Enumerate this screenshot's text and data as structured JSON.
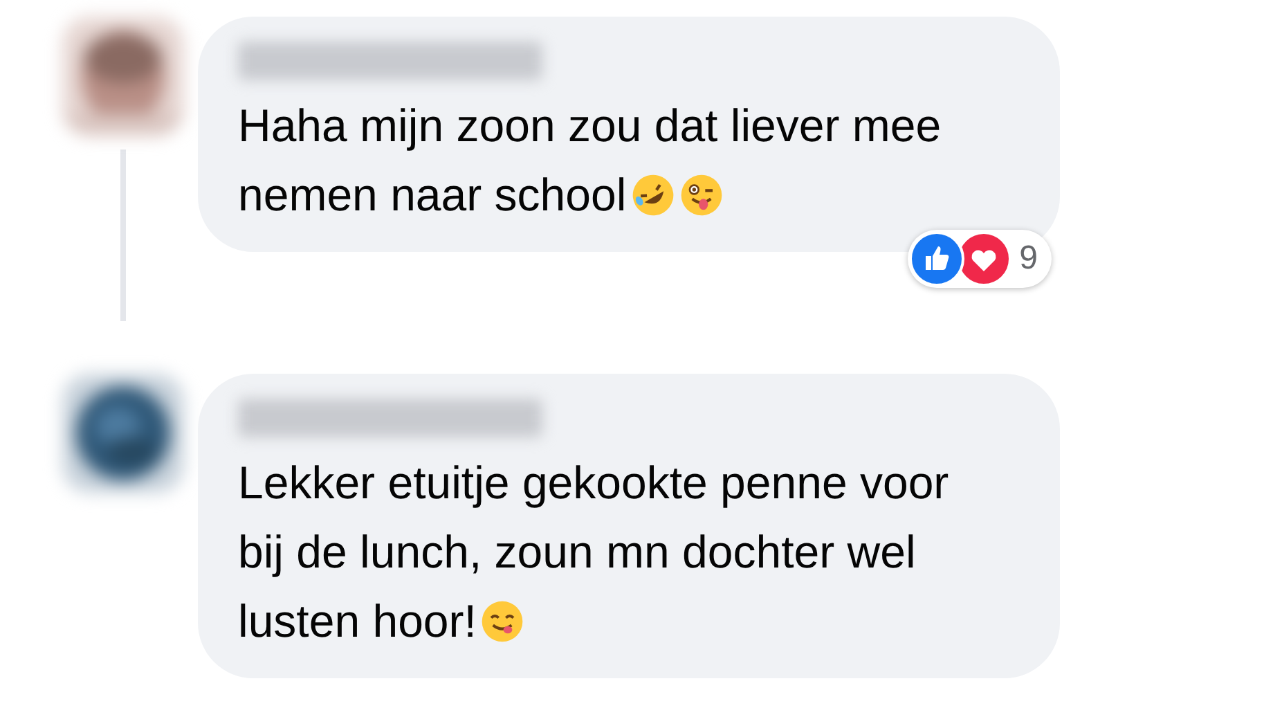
{
  "comments": [
    {
      "lines": [
        "Haha mijn zoon zou dat liever mee",
        "nemen naar school"
      ],
      "emojis": [
        {
          "kind": "rofl"
        },
        {
          "kind": "wink"
        }
      ],
      "reactions": {
        "items": [
          {
            "kind": "like"
          },
          {
            "kind": "love"
          }
        ],
        "count": "9"
      },
      "has_thread_line": true
    },
    {
      "lines": [
        "Lekker etuitje gekookte penne voor",
        "bij de lunch, zoun mn dochter wel",
        "lusten hoor!"
      ],
      "emojis": [
        {
          "kind": "yum"
        }
      ],
      "has_thread_line": false
    }
  ]
}
